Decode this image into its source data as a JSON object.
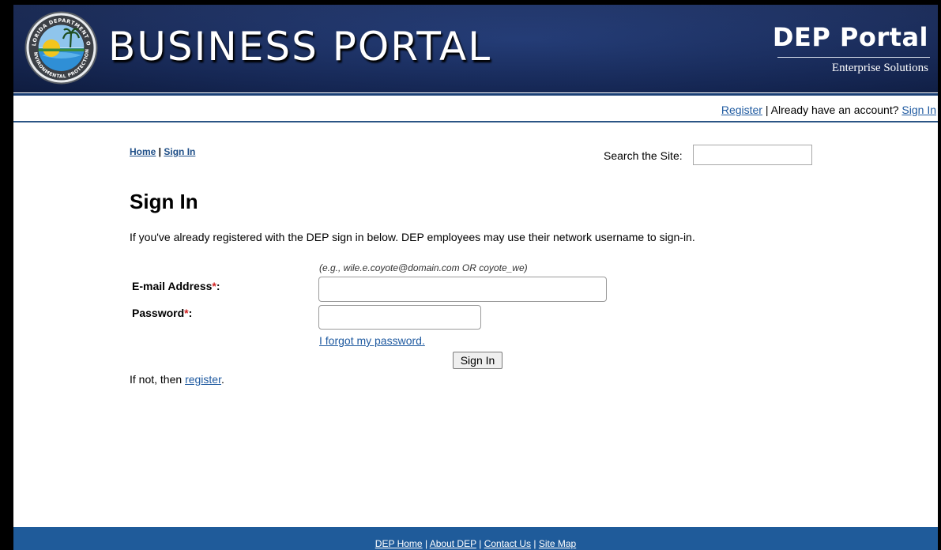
{
  "header": {
    "title": "BUSINESS PORTAL",
    "brand": "DEP Portal",
    "brand_subtitle": "Enterprise Solutions",
    "seal_text": "FLORIDA DEPARTMENT OF ENVIRONMENTAL PROTECTION"
  },
  "userbar": {
    "register": "Register",
    "separator": " | ",
    "prompt": "Already have an account? ",
    "sign_in": "Sign In"
  },
  "breadcrumb": {
    "home": "Home",
    "separator": " | ",
    "current": "Sign In"
  },
  "search": {
    "label": "Search the Site:",
    "value": ""
  },
  "main": {
    "title": "Sign In",
    "intro": "If you've already registered with the DEP sign in below. DEP employees may use their network username to sign-in.",
    "email_hint": "(e.g., wile.e.coyote@domain.com OR coyote_we)",
    "email_label": "E-mail Address",
    "password_label": "Password",
    "required_mark": "*",
    "label_colon": ":",
    "email_value": "",
    "password_value": "",
    "forgot_link": "I forgot my password.",
    "submit_label": "Sign In",
    "if_not_prefix": "If not, then ",
    "register_link": "register",
    "if_not_suffix": "."
  },
  "footer": {
    "links": [
      "DEP Home",
      "About DEP",
      "Contact Us",
      "Site Map"
    ],
    "separator": " | "
  },
  "colors": {
    "banner": "#16295a",
    "footer": "#1f5b9a",
    "link": "#1f5aa0",
    "required": "#d02020"
  }
}
